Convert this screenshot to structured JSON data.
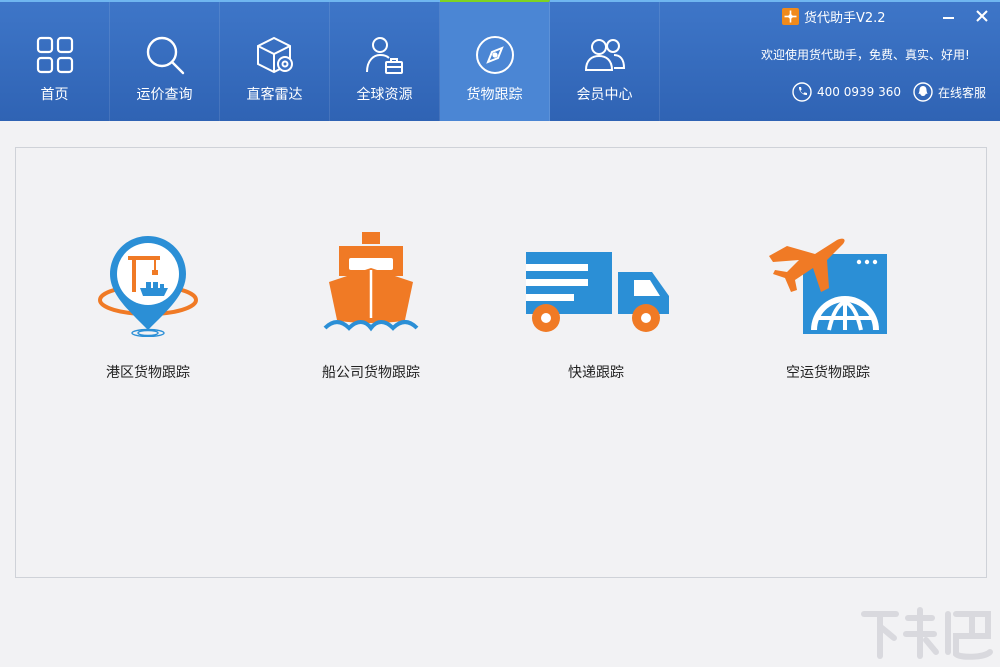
{
  "app": {
    "title": "货代助手V2.2",
    "welcome": "欢迎使用货代助手，免费、真实、好用!",
    "phone": "400 0939 360",
    "online_service": "在线客服"
  },
  "nav": {
    "items": [
      {
        "label": "首页",
        "icon": "grid-icon"
      },
      {
        "label": "运价查询",
        "icon": "search-icon"
      },
      {
        "label": "直客雷达",
        "icon": "box-radar-icon"
      },
      {
        "label": "全球资源",
        "icon": "person-briefcase-icon"
      },
      {
        "label": "货物跟踪",
        "icon": "compass-icon",
        "active": true
      },
      {
        "label": "会员中心",
        "icon": "users-icon"
      }
    ]
  },
  "main": {
    "cards": [
      {
        "label": "港区货物跟踪",
        "icon": "port-location-icon"
      },
      {
        "label": "船公司货物跟踪",
        "icon": "ship-icon"
      },
      {
        "label": "快递跟踪",
        "icon": "truck-icon"
      },
      {
        "label": "空运货物跟踪",
        "icon": "airplane-globe-icon"
      }
    ]
  },
  "colors": {
    "header_blue": "#3a70c3",
    "active_tab": "#4b86d4",
    "active_indicator": "#7ed321",
    "icon_orange": "#f07a25",
    "icon_blue": "#2b8fd6"
  },
  "watermark": "下载吧"
}
